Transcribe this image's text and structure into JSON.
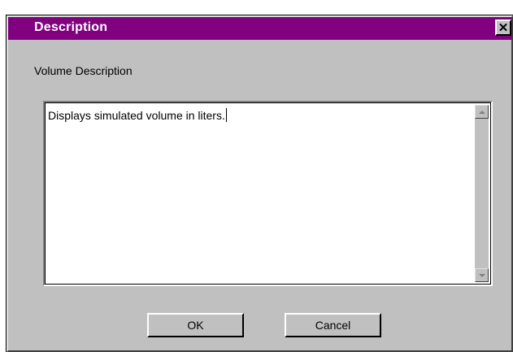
{
  "dialog": {
    "title": "Description",
    "close_label": "✕"
  },
  "field": {
    "label": "Volume Description",
    "value": "Displays simulated volume in liters."
  },
  "buttons": {
    "ok_label": "OK",
    "cancel_label": "Cancel"
  },
  "colors": {
    "titlebar": "#800080",
    "face": "#c0c0c0",
    "text_background": "#ffffff"
  },
  "icons": {
    "close": "close-icon",
    "scroll_up": "scroll-up-arrow-icon",
    "scroll_down": "scroll-down-arrow-icon"
  }
}
